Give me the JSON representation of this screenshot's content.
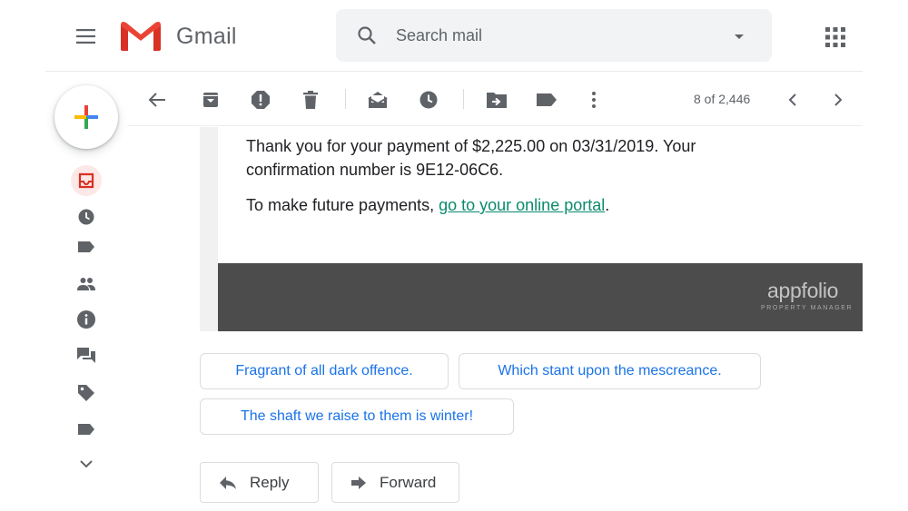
{
  "header": {
    "menu_icon": "hamburger-menu-icon",
    "logo_icon": "gmail-m-logo",
    "app_name": "Gmail",
    "search": {
      "placeholder": "Search mail",
      "value": ""
    },
    "apps_icon": "apps-grid-icon"
  },
  "sidebar": {
    "compose_icon": "compose-plus-icon",
    "items": [
      {
        "icon": "inbox-icon",
        "active": true
      },
      {
        "icon": "clock-icon"
      },
      {
        "icon": "label-icon"
      },
      {
        "icon": "people-icon"
      },
      {
        "icon": "info-icon"
      },
      {
        "icon": "forums-icon"
      },
      {
        "icon": "tag-icon"
      },
      {
        "icon": "label-icon"
      },
      {
        "icon": "chevron-down-icon"
      }
    ]
  },
  "toolbar": {
    "actions": [
      "back-arrow-icon",
      "archive-icon",
      "report-spam-icon",
      "delete-icon",
      "mark-unread-icon",
      "snooze-icon",
      "move-to-icon",
      "labels-icon",
      "more-vert-icon"
    ],
    "counter": "8 of 2,446",
    "nav": [
      "chevron-left-icon",
      "chevron-right-icon"
    ]
  },
  "email": {
    "line1": "Thank you for your payment of $2,225.00 on 03/31/2019. Your",
    "line2": "confirmation number is 9E12-06C6.",
    "line3_prefix": "To make future payments, ",
    "link_text": "go to your online portal",
    "line3_suffix": ".",
    "footer": {
      "logo_text": "appfolio",
      "logo_subtext": "PROPERTY MANAGER"
    }
  },
  "smart_replies": [
    "Fragrant of all dark offence.",
    "Which stant upon the mescreance.",
    "The shaft we raise to them is winter!"
  ],
  "actions": {
    "reply_label": "Reply",
    "forward_label": "Forward"
  },
  "colors": {
    "accent": "#1a73e8",
    "link": "#0b8a6e",
    "inbox_red": "#d93025",
    "footer_bg": "#4c4c4c"
  }
}
